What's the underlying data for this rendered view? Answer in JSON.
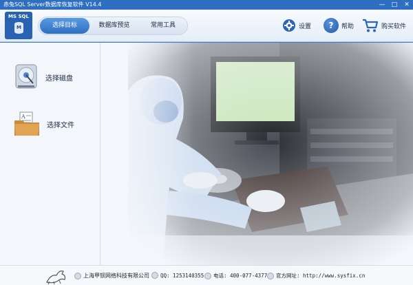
{
  "window": {
    "title": "赤兔SQL Server数据库恢复软件 V14.4",
    "controls": [
      "—",
      "□",
      "✕"
    ]
  },
  "logo": {
    "text": "MS SQL",
    "db_letter": "M"
  },
  "tabs": [
    {
      "label": "选择目标",
      "active": true
    },
    {
      "label": "数据库预览",
      "active": false
    },
    {
      "label": "常用工具",
      "active": false
    }
  ],
  "actions": {
    "settings": "设置",
    "help": "帮助",
    "buy": "购买软件"
  },
  "sidebar": {
    "items": [
      {
        "label": "选择磁盘",
        "icon": "disk-icon"
      },
      {
        "label": "选择文件",
        "icon": "folder-file-icon"
      }
    ]
  },
  "status": {
    "company": "上海甲钡网络科技有限公司",
    "qq": "QQ: 1253140355",
    "phone": "电话: 400-077-4377",
    "website": "官方网址: http://www.sysfix.cn"
  },
  "colors": {
    "accent": "#2f6fc2",
    "titlebar": "#2f6fc2"
  }
}
